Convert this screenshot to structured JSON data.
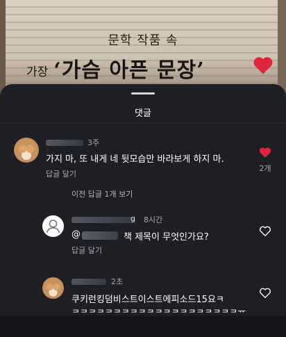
{
  "video": {
    "headline_top": "문학 작품 속",
    "headline_small": "가장",
    "headline_big": "‘가슴 아픈 문장’",
    "heart_color": "#e0243c"
  },
  "sheet": {
    "title": "댓글"
  },
  "comments": [
    {
      "time": "3주",
      "text": "가지 마, 또 내게 네 뒷모습만 바라보게 하지 마.",
      "reply_label": "답글 달기",
      "liked": true,
      "like_count": "2개",
      "like_icon": "heart-filled-icon"
    }
  ],
  "view_previous_replies": "이전 답글 1개 보기",
  "replies": [
    {
      "username_visible": "g",
      "time": "8시간",
      "mention_prefix": "@",
      "text": "책 제목이 무엇인가요?",
      "reply_label": "답글 달기",
      "liked": false,
      "like_icon": "heart-outline-icon"
    },
    {
      "time": "2초",
      "text_line1": "쿠키런킹덤비스트이스트에피소드15요ㅋ",
      "text_line2": "ㅋㅋㅋㅋㅋㅋㅋㅋㅋㅋㅋㅋㅋㅋㅋㅋㅋㅋㅋㅋㅠ",
      "liked": false,
      "like_icon": "heart-outline-icon"
    }
  ],
  "colors": {
    "sheet_bg": "#1e1f25",
    "like_red": "#e0243c",
    "muted_text": "#a8a9b0"
  }
}
